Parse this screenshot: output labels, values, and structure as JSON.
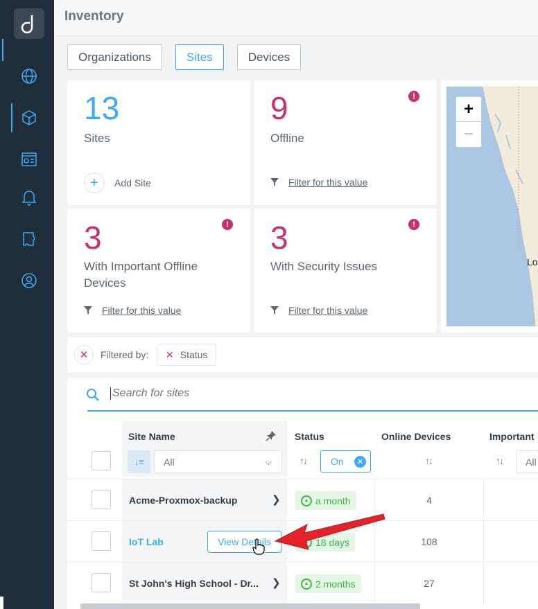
{
  "header": {
    "title": "Inventory"
  },
  "tabs": [
    {
      "label": "Organizations",
      "active": false
    },
    {
      "label": "Sites",
      "active": true
    },
    {
      "label": "Devices",
      "active": false
    }
  ],
  "sidebar": {
    "items": [
      {
        "icon": "globe-icon"
      },
      {
        "icon": "cube-icon",
        "active": true
      },
      {
        "icon": "dashboard-icon"
      },
      {
        "icon": "bell-icon"
      },
      {
        "icon": "puzzle-icon"
      },
      {
        "icon": "support-icon"
      }
    ]
  },
  "cards": {
    "sites": {
      "value": "13",
      "label": "Sites",
      "action": "Add Site"
    },
    "offline": {
      "value": "9",
      "label": "Offline",
      "link": "Filter for this value"
    },
    "important_offline": {
      "value": "3",
      "label": "With Important Offline Devices",
      "link": "Filter for this value"
    },
    "security": {
      "value": "3",
      "label": "With Security Issues",
      "link": "Filter for this value"
    }
  },
  "map": {
    "zoom_in": "+",
    "zoom_out": "−",
    "label": "Lo"
  },
  "filter": {
    "label": "Filtered by:",
    "chip": "Status"
  },
  "search": {
    "placeholder": "Search for sites"
  },
  "table": {
    "columns": {
      "site_name": "Site Name",
      "status": "Status",
      "online_devices": "Online Devices",
      "important": "Important"
    },
    "filters": {
      "site_name": "All",
      "status": "On",
      "important": "All"
    },
    "rows": [
      {
        "name": "Acme-Proxmox-backup",
        "status": "a month",
        "online": "4"
      },
      {
        "name": "IoT Lab",
        "status": "18 days",
        "online": "108",
        "action": "View Details"
      },
      {
        "name": "St John's High School - Dr...",
        "status": "2 months",
        "online": "27"
      }
    ]
  },
  "colors": {
    "accent": "#3fa9f5",
    "alert": "#c7306c",
    "sidebar": "#1f2d3a",
    "online": "#3bb54a"
  }
}
